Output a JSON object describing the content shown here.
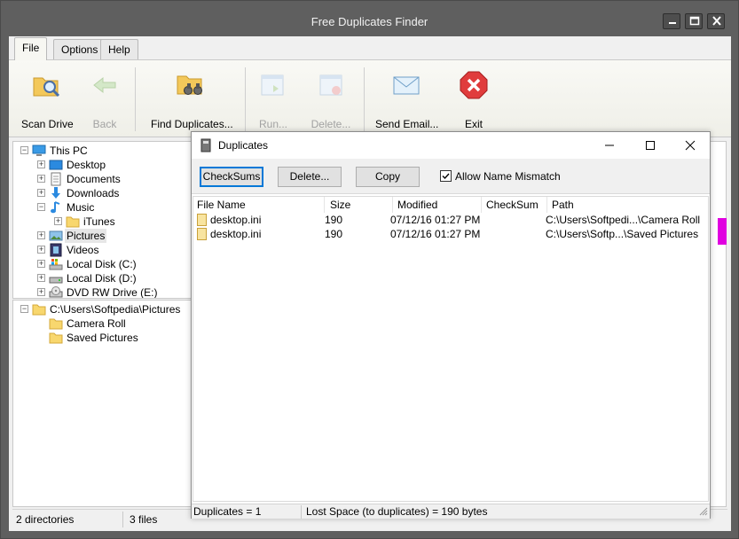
{
  "window": {
    "title": "Free Duplicates Finder"
  },
  "tabs": [
    {
      "label": "File"
    },
    {
      "label": "Options"
    },
    {
      "label": "Help"
    }
  ],
  "ribbon": {
    "scan_drive": "Scan Drive",
    "back": "Back",
    "find_duplicates": "Find Duplicates...",
    "run": "Run...",
    "delete": "Delete...",
    "send_email": "Send Email...",
    "exit": "Exit"
  },
  "tree": {
    "root": "This PC",
    "items": [
      {
        "label": "Desktop"
      },
      {
        "label": "Documents"
      },
      {
        "label": "Downloads"
      },
      {
        "label": "Music"
      },
      {
        "label": "iTunes"
      },
      {
        "label": "Pictures"
      },
      {
        "label": "Videos"
      },
      {
        "label": "Local Disk (C:)"
      },
      {
        "label": "Local Disk (D:)"
      },
      {
        "label": "DVD RW Drive (E:)"
      }
    ]
  },
  "folder_tree": {
    "root": "C:\\Users\\Softpedia\\Pictures",
    "items": [
      {
        "label": "Camera Roll"
      },
      {
        "label": "Saved Pictures"
      }
    ]
  },
  "status": {
    "directories": "2 directories",
    "files": "3 files"
  },
  "dialog": {
    "title": "Duplicates",
    "checksums_button": "CheckSums",
    "delete_button": "Delete...",
    "copy_button": "Copy",
    "allow_name_mismatch": "Allow Name Mismatch",
    "columns": [
      "File Name",
      "Size",
      "Modified",
      "CheckSum",
      "Path"
    ],
    "rows": [
      {
        "name": "desktop.ini",
        "size": "190",
        "modified": "07/12/16 01:27 PM",
        "checksum": "",
        "path": "C:\\Users\\Softpedi...\\Camera Roll"
      },
      {
        "name": "desktop.ini",
        "size": "190",
        "modified": "07/12/16 01:27 PM",
        "checksum": "",
        "path": "C:\\Users\\Softp...\\Saved Pictures"
      }
    ],
    "status_duplicates": "Duplicates = 1",
    "status_lost_space": "Lost Space (to duplicates) = 190 bytes"
  }
}
